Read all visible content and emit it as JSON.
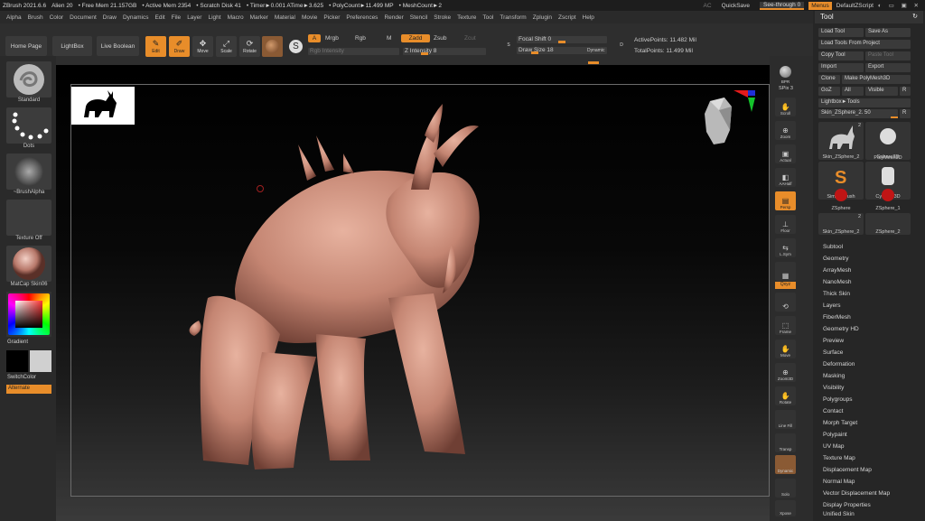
{
  "titlebar": {
    "app": "ZBrush 2021.6.6",
    "project": "Alien 20",
    "free_mem": "• Free Mem 21.157GB",
    "active_mem": "• Active Mem 2354",
    "scratch": "• Scratch Disk 41",
    "timer": "• Timer►0.001 ATime►3.625",
    "polycount": "• PolyCount►11.499 MP",
    "meshcount": "• MeshCount►2",
    "ac": "AC",
    "quicksave": "QuickSave",
    "seethrough": "See-through 0",
    "menus": "Menus",
    "script": "DefaultZScript"
  },
  "menus": [
    "Alpha",
    "Brush",
    "Color",
    "Document",
    "Draw",
    "Dynamics",
    "Edit",
    "File",
    "Layer",
    "Light",
    "Macro",
    "Marker",
    "Material",
    "Movie",
    "Picker",
    "Preferences",
    "Render",
    "Stencil",
    "Stroke",
    "Texture",
    "Tool",
    "Transform",
    "Zplugin",
    "Zscript",
    "Help"
  ],
  "toolbar": {
    "home": "Home Page",
    "lightbox": "LightBox",
    "liveboolean": "Live Boolean",
    "edit": "Edit",
    "draw": "Draw",
    "move": "Move",
    "scale": "Scale",
    "rotate": "Rotate",
    "a": "A",
    "mrgb": "Mrgb",
    "rgb": "Rgb",
    "m": "M",
    "zadd": "Zadd",
    "zsub": "Zsub",
    "zcut": "Zcut",
    "rgb_intensity": "Rgb Intensity",
    "z_intensity": "Z Intensity 8",
    "focal_shift": "Focal Shift 0",
    "draw_size": "Draw Size 18",
    "dynamic": "Dynamic",
    "active_points": "ActivePoints: 11.482 Mil",
    "total_points": "TotalPoints: 11.499 Mil",
    "s": "S",
    "d": "D"
  },
  "progress": {
    "z_intensity": 0.08,
    "draw_size": 0.18,
    "focal_shift": 0.5
  },
  "leftshelf": {
    "brush": "Standard",
    "stroke": "Dots",
    "alpha": "~BrushAlpha",
    "texture": "Texture Off",
    "material": "MatCap Skin06",
    "gradient": "Gradient",
    "switchcolor": "SwitchColor",
    "alternate": "Alternate"
  },
  "rightshelf": [
    "BPR",
    "SPix 3",
    "Scroll",
    "Zoom",
    "Actual",
    "AAHalf",
    "Persp",
    "Floor",
    "L.Sym",
    "Frame",
    "Move",
    "Zoom3D",
    "Rotate",
    "Line Fill",
    "PolyF",
    "Transp",
    "Dynamic",
    "Solo",
    "Xpose"
  ],
  "toolpanel": {
    "title": "Tool",
    "load": "Load Tool",
    "saveas": "Save As",
    "loadproject": "Load Tools From Project",
    "copy": "Copy Tool",
    "paste": "Paste Tool",
    "import": "Import",
    "export": "Export",
    "clone": "Clone",
    "makepoly": "Make PolyMesh3D",
    "goz": "GoZ",
    "all": "All",
    "visible": "Visible",
    "r": "R",
    "lightbox_tools": "Lightbox►Tools",
    "current": "Skin_ZSphere_2. 50",
    "current_r": "R"
  },
  "tools": [
    {
      "label": "Skin_ZSphere_2",
      "count": "2"
    },
    {
      "label": "Sphere3D",
      "count": ""
    },
    {
      "label": "SimpleBrush",
      "count": ""
    },
    {
      "label": "PolyMesh3D",
      "count": ""
    },
    {
      "label": "ZSphere",
      "count": ""
    },
    {
      "label": "Cylinder3D",
      "count": ""
    },
    {
      "label": "Skin_ZSphere_2",
      "count": "2"
    },
    {
      "label": "ZSphere_1",
      "count": ""
    },
    {
      "label": "ZSphere_2",
      "count": ""
    }
  ],
  "subpalettes": [
    "Subtool",
    "Geometry",
    "ArrayMesh",
    "NanoMesh",
    "Thick Skin",
    "Layers",
    "FiberMesh",
    "Geometry HD",
    "Preview",
    "Surface",
    "Deformation",
    "Masking",
    "Visibility",
    "Polygroups",
    "Contact",
    "Morph Target",
    "Polypaint",
    "UV Map",
    "Texture Map",
    "Displacement Map",
    "Normal Map",
    "Vector Displacement Map",
    "Display Properties",
    "Unified Skin"
  ],
  "colors": {
    "accent": "#e88d2a",
    "model": "#c48572",
    "background": "#262626"
  }
}
